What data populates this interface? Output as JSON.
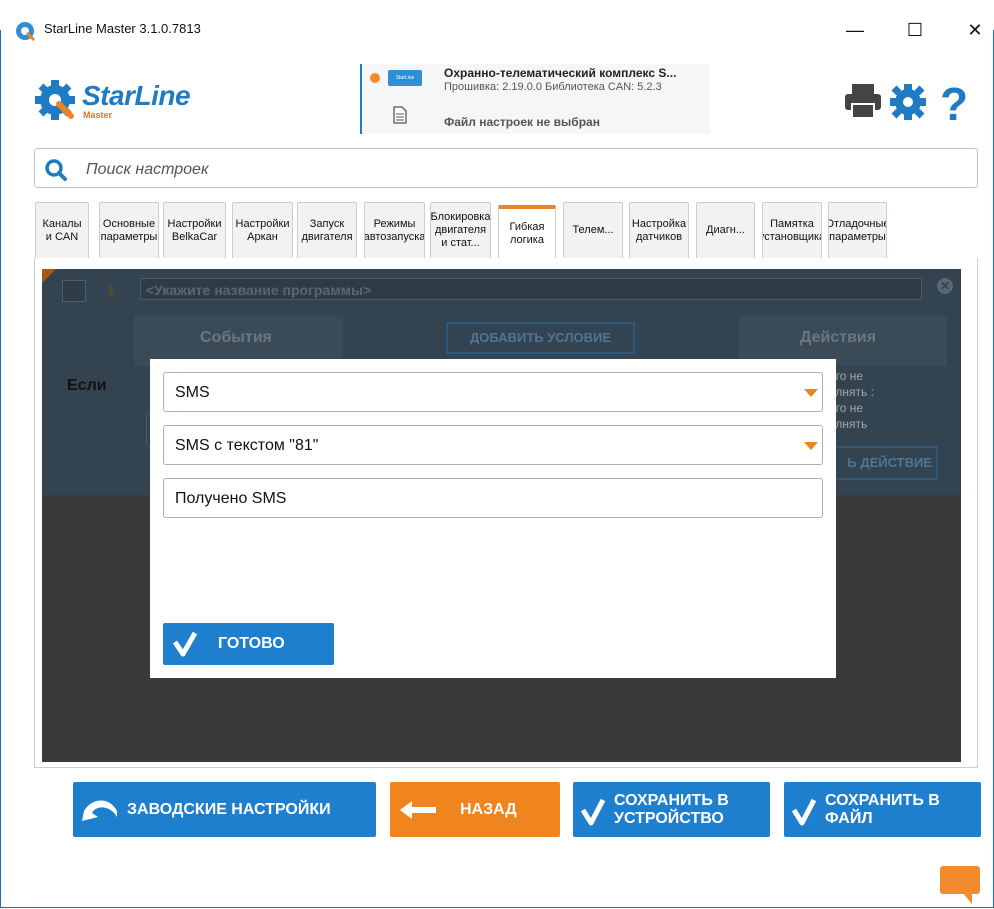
{
  "window": {
    "title": "StarLine Master 3.1.0.7813",
    "minimize_glyph": "—",
    "maximize_glyph": "☐",
    "close_glyph": "✕"
  },
  "header": {
    "logo_text": "StarLine",
    "logo_sub": "Master",
    "device_chip": "StarLine",
    "device_name": "Охранно-телематический комплекс S...",
    "firmware": "Прошивка: 2.19.0.0   Библиотека CAN: 5.2.3",
    "settings_file": "Файл настроек не выбран",
    "status_color": "#f28a2e",
    "icons": [
      "print-icon",
      "gear-icon",
      "help-icon"
    ]
  },
  "search": {
    "placeholder": "Поиск настроек"
  },
  "tabs": [
    {
      "label": "Каналы\nи CAN"
    },
    {
      "label": "Основные\nпараметры"
    },
    {
      "label": "Настройки\nBelkaCar"
    },
    {
      "label": "Настройки\nАркан"
    },
    {
      "label": "Запуск\nдвигателя"
    },
    {
      "label": "Режимы\nавтозапуска"
    },
    {
      "label": "Блокировка\nдвигателя\nи стат..."
    },
    {
      "label": "Гибкая\nлогика",
      "active": true
    },
    {
      "label": "Телем..."
    },
    {
      "label": "Настройка\nдатчиков"
    },
    {
      "label": "Диагн..."
    },
    {
      "label": "Памятка\nустановщика"
    },
    {
      "label": "Отладочные\nпараметры"
    }
  ],
  "program": {
    "number": "1",
    "name_placeholder": "<Укажите название программы>",
    "events_header": "События",
    "add_condition": "ДОБАВИТЬ УСЛОВИЕ",
    "actions_header": "Действия",
    "if_label": "Если",
    "actions_text": "его не\nолнять :\nего не\nолнять",
    "add_action": "Ь ДЕЙСТВИЕ"
  },
  "modal": {
    "select1": "SMS",
    "select2": "SMS с текстом \"81\"",
    "text_field": "Получено SMS",
    "done_label": "ГОТОВО"
  },
  "footer": {
    "factory": "ЗАВОДСКИЕ НАСТРОЙКИ",
    "back": "НАЗАД",
    "save_device": "СОХРАНИТЬ В\nУСТРОЙСТВО",
    "save_file": "СОХРАНИТЬ В\nФАЙЛ",
    "colors": {
      "blue": "#1e7fce",
      "orange": "#f0841f"
    }
  }
}
